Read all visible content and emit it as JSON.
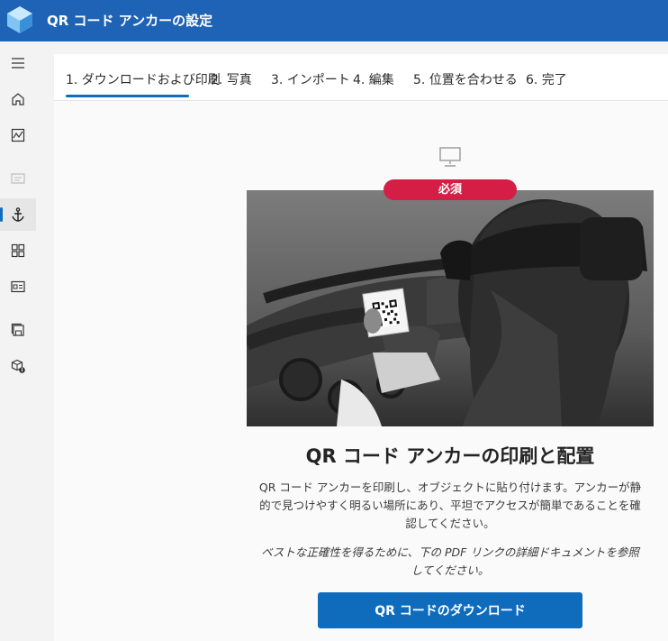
{
  "app": {
    "title": "QR コード アンカーの設定"
  },
  "rail": {
    "items": [
      {
        "icon": "hamburger-menu-icon"
      },
      {
        "icon": "home-icon"
      },
      {
        "icon": "activity-chart-icon"
      },
      {
        "icon": "note-icon",
        "disabled": true
      },
      {
        "icon": "anchor-icon",
        "active": true
      },
      {
        "icon": "grid-icon"
      },
      {
        "icon": "id-card-icon"
      },
      {
        "icon": "save-stack-icon"
      },
      {
        "icon": "package-info-icon"
      }
    ]
  },
  "tabs": [
    {
      "label": "1. ダウンロードおよび印刷",
      "selected": true
    },
    {
      "label": "2. 写真"
    },
    {
      "label": "3. インポート"
    },
    {
      "label": "4. 編集"
    },
    {
      "label": "5. 位置を合わせる"
    },
    {
      "label": "6. 完了"
    }
  ],
  "main": {
    "badge": "必須",
    "heading": "QR コード アンカーの印刷と配置",
    "description": "QR コード アンカーを印刷し、オブジェクトに貼り付けます。アンカーが静的で見つけやすく明るい場所にあり、平坦でアクセスが簡単であることを確認してください。",
    "note": "ベストな正確性を得るために、下の PDF リンクの詳細ドキュメントを参照してください。",
    "download_button": "QR コードのダウンロード"
  },
  "colors": {
    "titlebar": "#1e63b5",
    "accent": "#0f6cbd",
    "badge": "#d51e45"
  }
}
